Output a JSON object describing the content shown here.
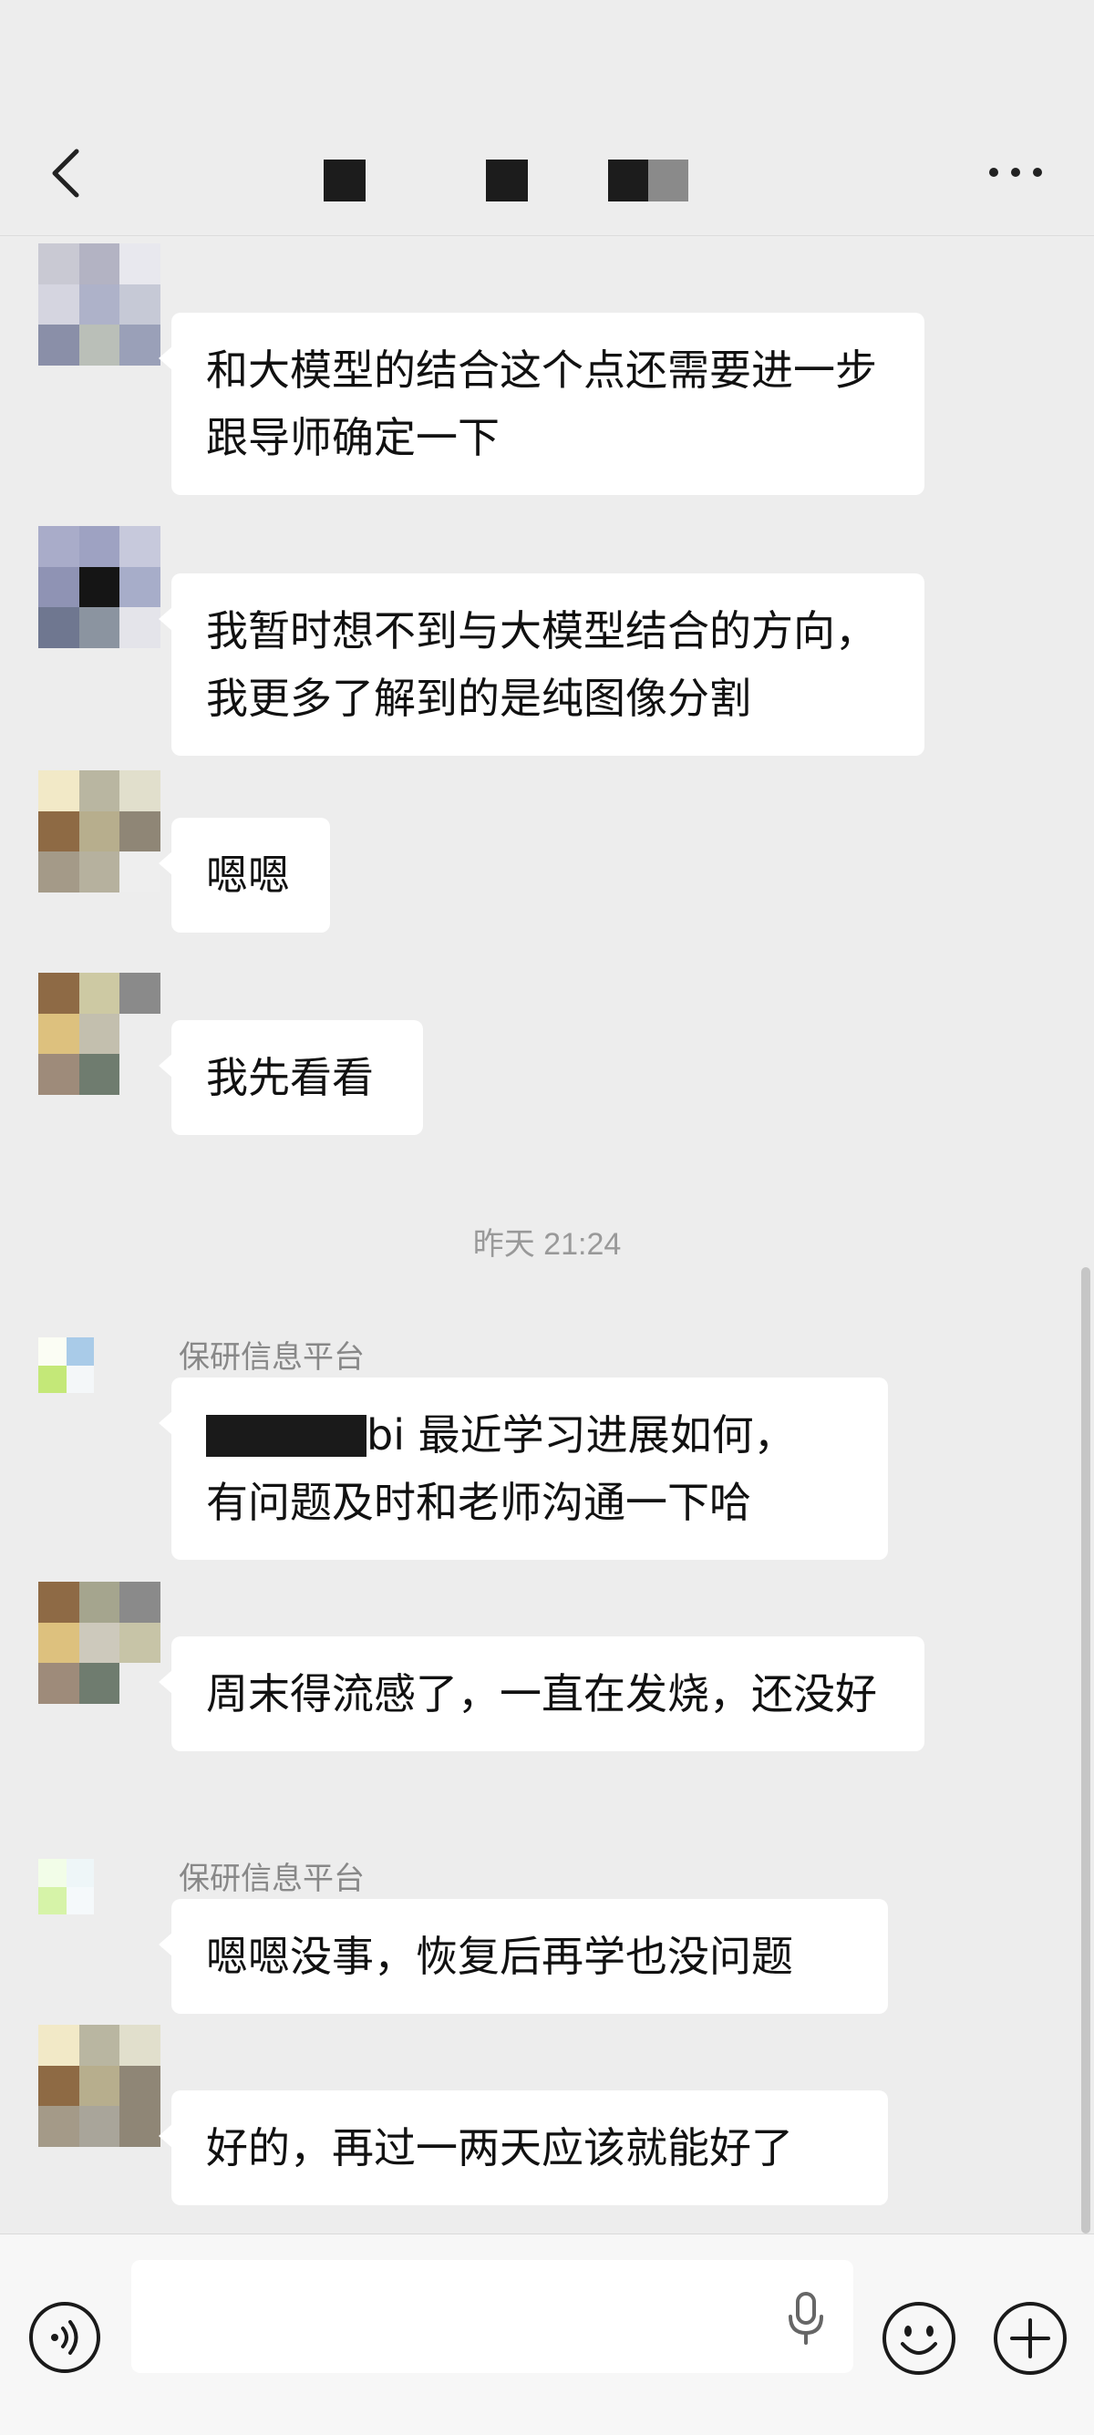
{
  "header": {
    "back_icon": "chevron-left-icon",
    "more_icon": "ellipsis-icon",
    "title_redacted": true
  },
  "messages": [
    {
      "sender": "",
      "text": "和大模型的结合这个点还需要​进一步跟导师确定一下"
    },
    {
      "sender": "",
      "text": "我暂时想不到与大模型结合的方向，我更多了解到的是纯图像分割"
    },
    {
      "sender": "",
      "text": "嗯嗯"
    },
    {
      "sender": "",
      "text": "我先看看"
    },
    {
      "timestamp": "昨天 21:24"
    },
    {
      "sender": "保研信息平台",
      "text_suffix": "bi  最近学习进展如何，",
      "text_line2": "有问题及时和老师沟通一下哈"
    },
    {
      "sender": "",
      "text": "周末得流感了，一直在发烧，还没好"
    },
    {
      "sender": "保研信息平台",
      "text": "嗯嗯没事，恢复后再学也没问题"
    },
    {
      "sender": "",
      "text": "好的，再过一两天应该就能好了"
    }
  ],
  "bottom_bar": {
    "voice_icon": "voice-toggle-icon",
    "mic_icon": "microphone-icon",
    "emoji_icon": "emoji-icon",
    "plus_icon": "plus-icon"
  }
}
